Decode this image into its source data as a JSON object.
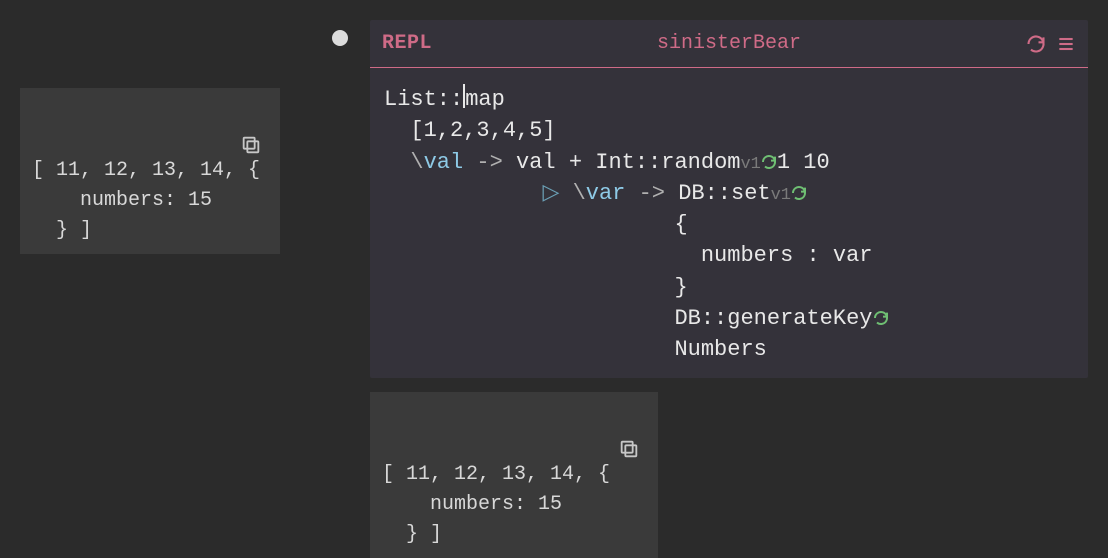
{
  "left_output": {
    "line1": "[ 11, 12, 13, 14, {",
    "line2": "    numbers: 15",
    "line3": "  } ]"
  },
  "bottom_output": {
    "line1": "[ 11, 12, 13, 14, {",
    "line2": "    numbers: 15",
    "line3": "  } ]"
  },
  "editor": {
    "header_label": "REPL",
    "title": "sinisterBear"
  },
  "code": {
    "l1_pre": "List::",
    "l1_post": "map",
    "l2_indent": "  ",
    "l2": "[1,2,3,4,5]",
    "l3_indent": "  ",
    "l3_bslash": "\\",
    "l3_param": "val",
    "l3_arrow": " -> ",
    "l3_body_a": "val + Int::random",
    "l3_ver": "v1",
    "l3_body_b": "1 10",
    "l4_indent": "            ",
    "l4_marker": "▷ ",
    "l4_bslash": "\\",
    "l4_param": "var",
    "l4_arrow": " -> ",
    "l4_body": "DB::set",
    "l4_ver": "v1",
    "l5_indent": "                      ",
    "l5": "{",
    "l6_indent": "                        ",
    "l6": "numbers : var",
    "l7_indent": "                      ",
    "l7": "}",
    "l8_indent": "                      ",
    "l8": "DB::generateKey",
    "l9_indent": "                      ",
    "l9": "Numbers"
  },
  "icons": {
    "copy": "copy-icon",
    "refresh": "refresh-icon",
    "menu": "menu-icon",
    "unsaved": "unsaved-dot",
    "play": "play-marker"
  }
}
